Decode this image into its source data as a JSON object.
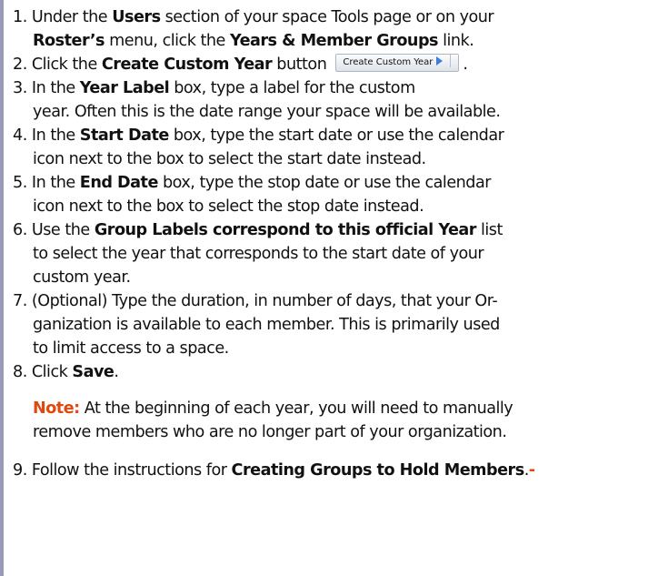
{
  "steps": [
    {
      "num": "1.",
      "t1": " Under the ",
      "b1": "Users",
      "t2": " section of your space Tools page or on your",
      "b2": "Roster’s",
      "t3": " menu, click the ",
      "b3": "Years & Member Groups",
      "t4": " link."
    },
    {
      "num": "2.",
      "t1": " Click the ",
      "b1": "Create Custom Year",
      "t2": " button",
      "t3": "."
    },
    {
      "num": "3.",
      "t1": " In the ",
      "b1": "Year Label",
      "t2": " box, type a label for the custom",
      "t3": "year. Often this is the date range your space will be available."
    },
    {
      "num": "4.",
      "t1": " In the ",
      "b1": "Start Date",
      "t2": " box, type the start date or use the calendar",
      "t3": "icon next to the box to select the start date instead."
    },
    {
      "num": "5.",
      "t1": " In the ",
      "b1": "End Date",
      "t2": " box, type the stop date or use the calendar",
      "t3": "icon next to the box to select the stop date instead."
    },
    {
      "num": "6.",
      "t1": " Use the ",
      "b1": "Group Labels correspond to this official Year",
      "t2": " list",
      "t3": "to select the year that corresponds to the start date of your",
      "t4": "custom year."
    },
    {
      "num": "7.",
      "t1": " (Optional) Type the duration, in number of days, that your Or-",
      "t2": "ganization is available to each member. This is primarily used",
      "t3": "to limit access to a space."
    },
    {
      "num": "8.",
      "t1": " Click ",
      "b1": "Save",
      "t2": "."
    },
    {
      "num": "9.",
      "t1": " Follow the instructions for ",
      "b1": "Creating Groups to Hold Members",
      "t2": ".",
      "t3": "-"
    }
  ],
  "note": {
    "label": "Note:",
    "line1": " At the beginning of each year, you will need to manually",
    "line2": "remove members who are no longer part of your organization."
  },
  "create_year_button": {
    "label": "Create Custom Year",
    "icon": "play-arrow-icon"
  },
  "colors": {
    "note_label": "#e1480e",
    "text": "#111111",
    "left_frame": "#9a9ab8"
  }
}
